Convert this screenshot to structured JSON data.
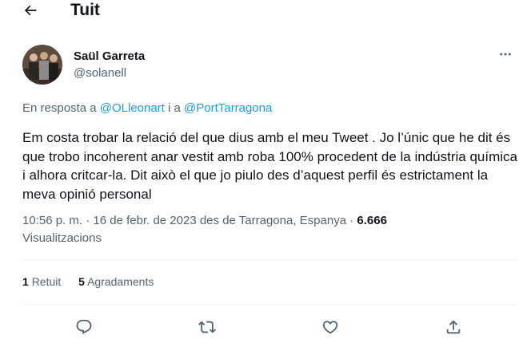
{
  "header": {
    "title": "Tuit",
    "back_icon": "arrow-left-icon"
  },
  "author": {
    "name": "Saül Garreta",
    "handle": "@solanell"
  },
  "reply": {
    "prefix": "En resposta a ",
    "user1": "@OLleonart",
    "joiner": " i a ",
    "user2": "@PortTarragona"
  },
  "tweet": {
    "text": "Em costa trobar la relació del que dius amb el meu Tweet . Jo l’únic que he dit és que trobo incoherent anar vestit amb roba 100% procedent de la indústria química i alhora critcar-la. Dit això el que jo piulo des d’aquest perfil és estrictament la meva opinió personal"
  },
  "meta": {
    "time": "10:56 p. m.",
    "date": "16 de febr. de 2023",
    "location": "des de Tarragona, Espanya",
    "views_count": "6.666",
    "views_label": "Visualitzacions",
    "sep": "·"
  },
  "stats": {
    "retweets_count": "1",
    "retweets_label": "Retuit",
    "likes_count": "5",
    "likes_label": "Agradaments"
  },
  "actions": [
    "reply-icon",
    "retweet-icon",
    "like-icon",
    "share-icon"
  ],
  "colors": {
    "link": "#1d9bf0",
    "secondary": "#536471",
    "text": "#0f1419",
    "divider": "#eff3f4"
  }
}
